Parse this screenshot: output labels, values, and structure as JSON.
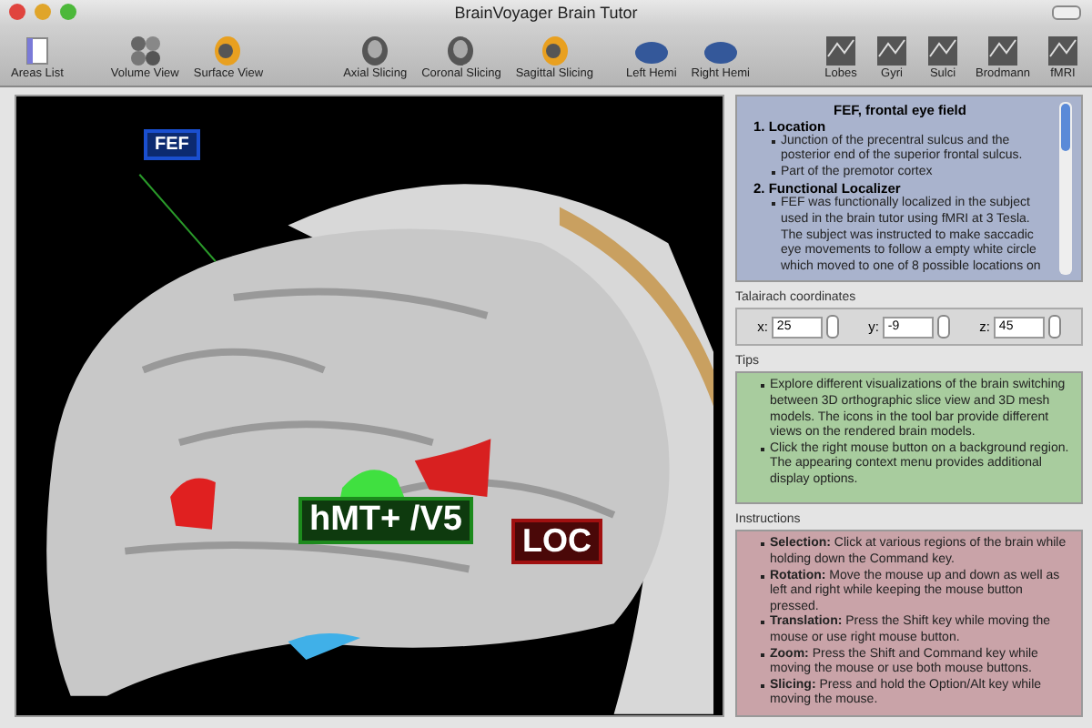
{
  "window": {
    "title": "BrainVoyager Brain Tutor"
  },
  "toolbar": {
    "groups": [
      [
        "Areas List"
      ],
      [
        "Volume View",
        "Surface View"
      ],
      [
        "Axial Slicing",
        "Coronal Slicing",
        "Sagittal Slicing"
      ],
      [
        "Left Hemi",
        "Right Hemi"
      ],
      [
        "Lobes",
        "Gyri",
        "Sulci",
        "Brodmann",
        "fMRI"
      ]
    ]
  },
  "viewport": {
    "labels": [
      {
        "text": "FEF",
        "color": "#1a4fd0"
      },
      {
        "text": "hMT+ /V5",
        "color": "#1c8a1c"
      },
      {
        "text": "LOC",
        "color": "#a01010"
      }
    ]
  },
  "info": {
    "title": "FEF, frontal eye field",
    "sections": [
      {
        "number": "1.",
        "heading": "Location",
        "bullets": [
          "Junction of the precentral sulcus and the posterior end of the superior frontal sulcus.",
          "Part of the premotor cortex"
        ]
      },
      {
        "number": "2.",
        "heading": "Functional Localizer",
        "bullets": [
          "FEF was functionally localized in the subject used in the brain tutor using fMRI at 3 Tesla. The subject was instructed to make saccadic eye movements to follow a empty white circle which moved to one of 8 possible locations on"
        ]
      }
    ]
  },
  "coordinates": {
    "label": "Talairach coordinates",
    "fields": [
      {
        "axis": "x:",
        "value": "25"
      },
      {
        "axis": "y:",
        "value": "-9"
      },
      {
        "axis": "z:",
        "value": "45"
      }
    ]
  },
  "tips": {
    "label": "Tips",
    "items": [
      "Explore different visualizations of the brain switching between 3D orthographic slice view and 3D mesh models. The icons in the tool bar provide different views on the rendered brain models.",
      "Click the right mouse button on a background region. The appearing context menu provides additional display options."
    ]
  },
  "instructions": {
    "label": "Instructions",
    "items": [
      {
        "term": "Selection:",
        "text": "Click at various regions of the brain while holding down the Command key."
      },
      {
        "term": "Rotation:",
        "text": "Move the mouse up and down as well as left and right while keeping the mouse button pressed."
      },
      {
        "term": "Translation:",
        "text": "Press the Shift key while moving the mouse or use right mouse button."
      },
      {
        "term": "Zoom:",
        "text": "Press the Shift and Command key while moving the mouse or use both mouse buttons."
      },
      {
        "term": "Slicing:",
        "text": "Press and hold the Option/Alt key while moving the mouse."
      }
    ]
  }
}
